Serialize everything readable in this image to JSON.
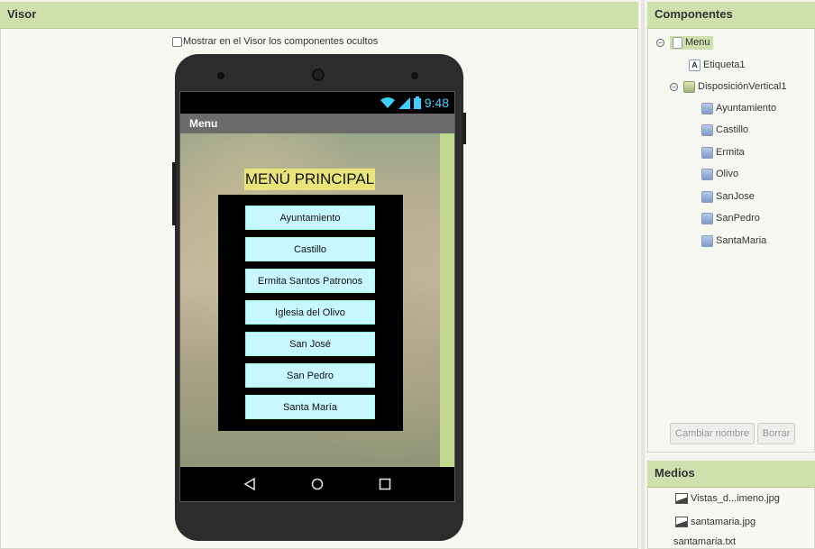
{
  "visor": {
    "title": "Visor",
    "show_hidden_label": "Mostrar en el Visor los componentes ocultos",
    "phone": {
      "time": "9:48",
      "screen_title": "Menu",
      "label_text": "MENÚ PRINCIPAL",
      "buttons": [
        "Ayuntamiento",
        "Castillo",
        "Ermita Santos Patronos",
        "Iglesia del Olivo",
        "San José",
        "San Pedro",
        "Santa María"
      ]
    }
  },
  "components": {
    "title": "Componentes",
    "tree": {
      "root": "Menu",
      "label": "Etiqueta1",
      "layout": "DisposiciónVertical1",
      "children": [
        "Ayuntamiento",
        "Castillo",
        "Ermita",
        "Olivo",
        "SanJose",
        "SanPedro",
        "SantaMaria"
      ]
    },
    "rename_label": "Cambiar nombre",
    "delete_label": "Borrar"
  },
  "media": {
    "title": "Medios",
    "files": [
      "Vistas_d...imeno.jpg",
      "santamaria.jpg",
      "santamaria.txt"
    ]
  },
  "colors": {
    "header_bg": "#cfe0ad",
    "button_bg": "#c8f8ff",
    "label_bg": "#e8e47a",
    "status_blue": "#3fd0ff"
  }
}
